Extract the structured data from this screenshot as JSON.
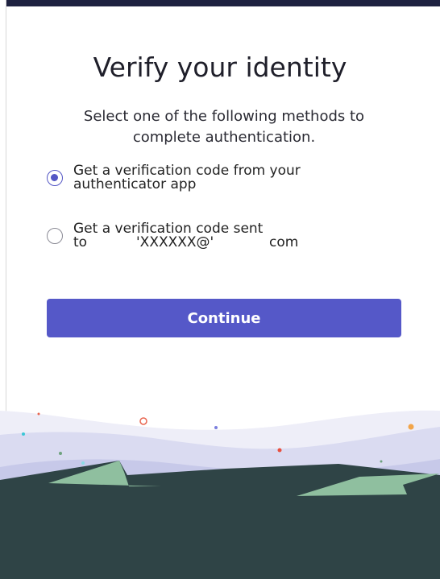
{
  "title": "Verify your identity",
  "subtitle": "Select one of the following methods to complete authentication.",
  "options": [
    {
      "label": "Get a verification code from your authenticator app",
      "selected": true
    },
    {
      "label_line1": "Get a verification code sent",
      "label_to": "to",
      "email_user": "'XXXXXX@'",
      "email_domain": "com",
      "selected": false
    }
  ],
  "continue_button": "Continue",
  "colors": {
    "accent": "#5558c8",
    "dark_landscape": "#2f4446",
    "hill_green": "#8fbf9f",
    "haze": "#d9daf2"
  }
}
